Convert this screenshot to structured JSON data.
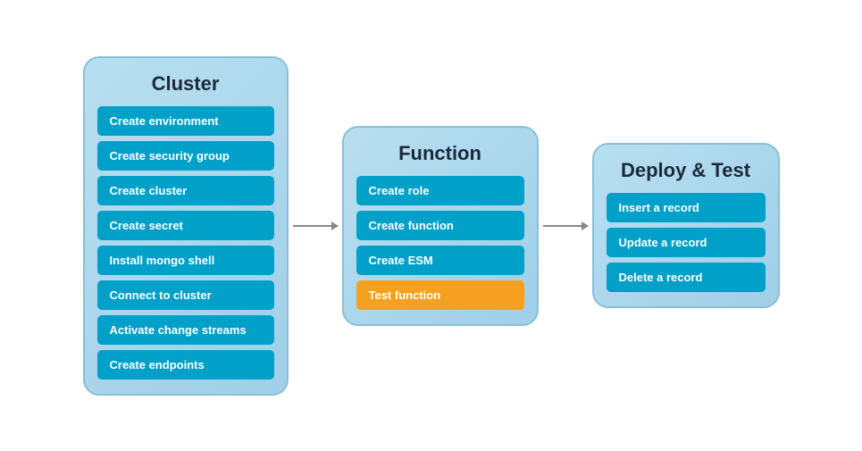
{
  "panels": [
    {
      "id": "cluster",
      "title": "Cluster",
      "items": [
        {
          "label": "Create environment",
          "style": "normal"
        },
        {
          "label": "Create security group",
          "style": "normal"
        },
        {
          "label": "Create cluster",
          "style": "normal"
        },
        {
          "label": "Create secret",
          "style": "normal"
        },
        {
          "label": "Install mongo shell",
          "style": "normal"
        },
        {
          "label": "Connect to cluster",
          "style": "normal"
        },
        {
          "label": "Activate change streams",
          "style": "normal"
        },
        {
          "label": "Create endpoints",
          "style": "normal"
        }
      ]
    },
    {
      "id": "function",
      "title": "Function",
      "items": [
        {
          "label": "Create role",
          "style": "normal"
        },
        {
          "label": "Create function",
          "style": "normal"
        },
        {
          "label": "Create ESM",
          "style": "normal"
        },
        {
          "label": "Test function",
          "style": "orange"
        }
      ]
    },
    {
      "id": "deploy",
      "title": "Deploy & Test",
      "items": [
        {
          "label": "Insert a record",
          "style": "normal"
        },
        {
          "label": "Update a record",
          "style": "normal"
        },
        {
          "label": "Delete a record",
          "style": "normal"
        }
      ]
    }
  ],
  "arrows": [
    "→",
    "→"
  ]
}
